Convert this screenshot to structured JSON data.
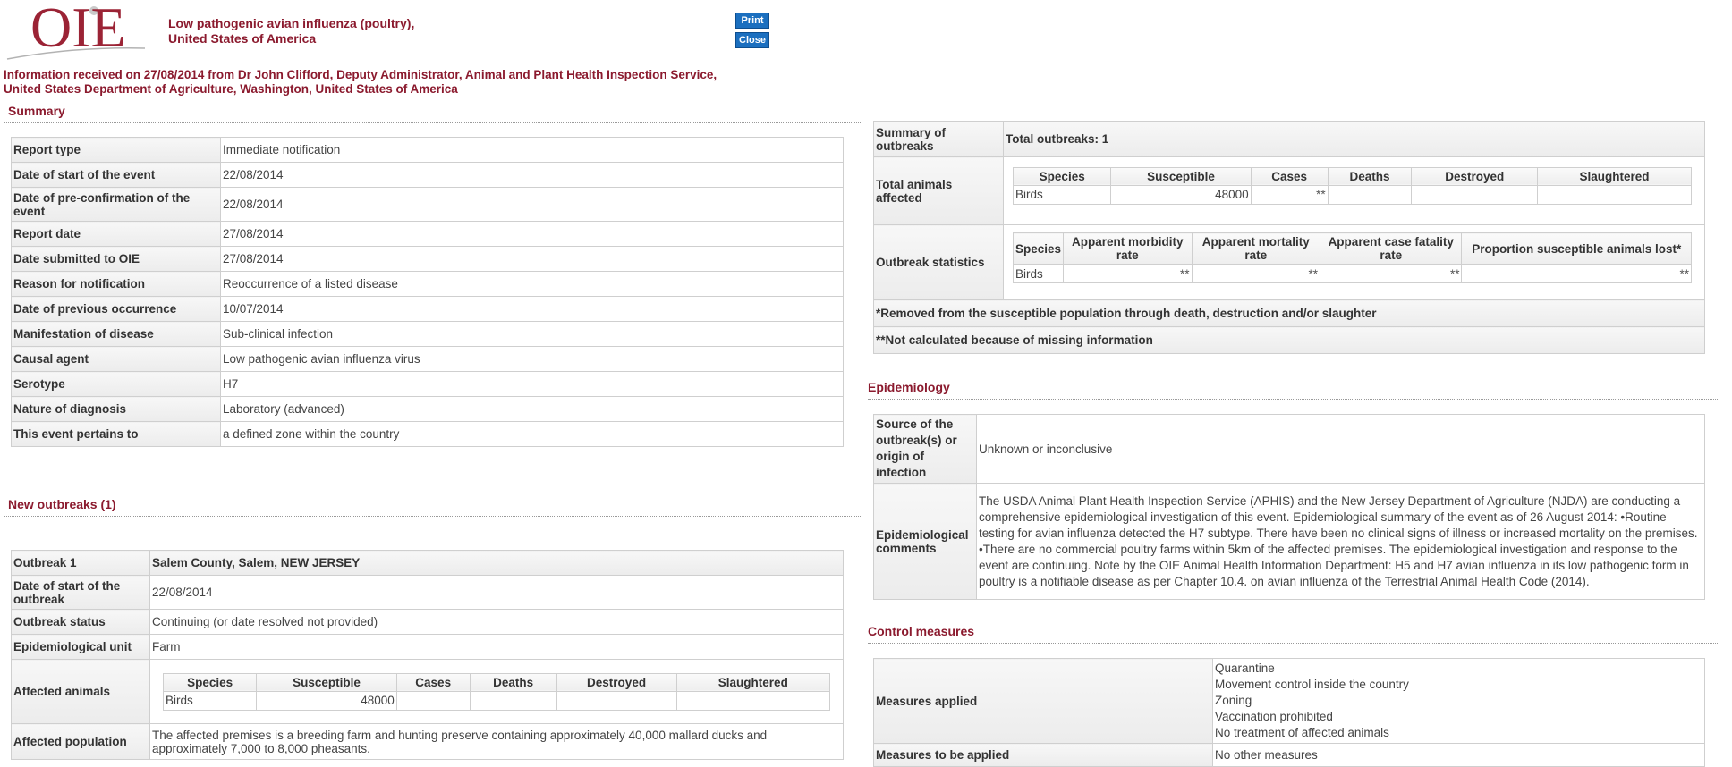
{
  "header": {
    "logo_text": "OIE",
    "title_line1": "Low pathogenic avian influenza (poultry),",
    "title_line2": "United States of America",
    "print_label": "Print",
    "close_label": "Close",
    "info_line1": "Information received on 27/08/2014 from Dr John Clifford, Deputy Administrator, Animal and Plant Health Inspection Service,",
    "info_line2": "United States Department of Agriculture, Washington, United States of America"
  },
  "summary": {
    "title": "Summary",
    "rows": [
      {
        "label": "Report type",
        "value": "Immediate notification"
      },
      {
        "label": "Date of start of the event",
        "value": "22/08/2014"
      },
      {
        "label": "Date of pre-confirmation of the event",
        "value": "22/08/2014"
      },
      {
        "label": "Report date",
        "value": "27/08/2014"
      },
      {
        "label": "Date submitted to OIE",
        "value": "27/08/2014"
      },
      {
        "label": "Reason for notification",
        "value": "Reoccurrence of a listed disease"
      },
      {
        "label": "Date of previous occurrence",
        "value": "10/07/2014"
      },
      {
        "label": "Manifestation of disease",
        "value": "Sub-clinical infection"
      },
      {
        "label": "Causal agent",
        "value": "Low pathogenic avian influenza virus"
      },
      {
        "label": "Serotype",
        "value": "H7"
      },
      {
        "label": "Nature of diagnosis",
        "value": "Laboratory (advanced)"
      },
      {
        "label": "This event pertains to",
        "value": "a defined zone within the country"
      }
    ]
  },
  "new_outbreaks": {
    "title": "New outbreaks (1)",
    "outbreak_label": "Outbreak 1",
    "outbreak_location": "Salem County, Salem, NEW JERSEY",
    "start_label": "Date of start of the outbreak",
    "start_value": "22/08/2014",
    "status_label": "Outbreak status",
    "status_value": "Continuing (or date resolved not provided)",
    "unit_label": "Epidemiological unit",
    "unit_value": "Farm",
    "affected_label": "Affected animals",
    "headers": [
      "Species",
      "Susceptible",
      "Cases",
      "Deaths",
      "Destroyed",
      "Slaughtered"
    ],
    "row": [
      "Birds",
      "48000",
      "",
      "",
      "",
      ""
    ],
    "population_label": "Affected population",
    "population_value": "The affected premises is a breeding farm and hunting preserve containing approximately 40,000 mallard ducks and approximately 7,000 to 8,000 pheasants."
  },
  "outbreak_summary": {
    "summary_label": "Summary of outbreaks",
    "summary_value": "Total outbreaks: 1",
    "total_label": "Total animals affected",
    "total_headers": [
      "Species",
      "Susceptible",
      "Cases",
      "Deaths",
      "Destroyed",
      "Slaughtered"
    ],
    "total_row": [
      "Birds",
      "48000",
      "**",
      "",
      "",
      ""
    ],
    "stats_label": "Outbreak statistics",
    "stats_headers": [
      "Species",
      "Apparent morbidity rate",
      "Apparent mortality rate",
      "Apparent case fatality rate",
      "Proportion susceptible animals lost*"
    ],
    "stats_row": [
      "Birds",
      "**",
      "**",
      "**",
      "**"
    ],
    "note1": "*Removed from the susceptible population through death, destruction and/or slaughter",
    "note2": "**Not calculated because of missing information"
  },
  "epidemiology": {
    "title": "Epidemiology",
    "source_label": "Source of the outbreak(s) or origin of infection",
    "source_value": "Unknown or inconclusive",
    "comments_label": "Epidemiological comments",
    "comments_value": "The USDA Animal Plant Health Inspection Service (APHIS) and the New Jersey Department of Agriculture (NJDA) are conducting a comprehensive epidemiological investigation of this event. Epidemiological summary of the event as of 26 August 2014: •Routine testing for avian influenza detected the H7 subtype. There have been no clinical signs of illness or increased mortality on the premises. •There are no commercial poultry farms within 5km of the affected premises. The epidemiological investigation and response to the event are continuing. Note by the OIE Animal Health Information Department: H5 and H7 avian influenza in its low pathogenic form in poultry is a notifiable disease as per Chapter 10.4. on avian influenza of the Terrestrial Animal Health Code (2014)."
  },
  "control": {
    "title": "Control measures",
    "applied_label": "Measures applied",
    "applied_values": [
      "Quarantine",
      "Movement control inside the country",
      "Zoning",
      "Vaccination prohibited",
      "No treatment of affected animals"
    ],
    "to_apply_label": "Measures to be applied",
    "to_apply_value": "No other measures"
  }
}
